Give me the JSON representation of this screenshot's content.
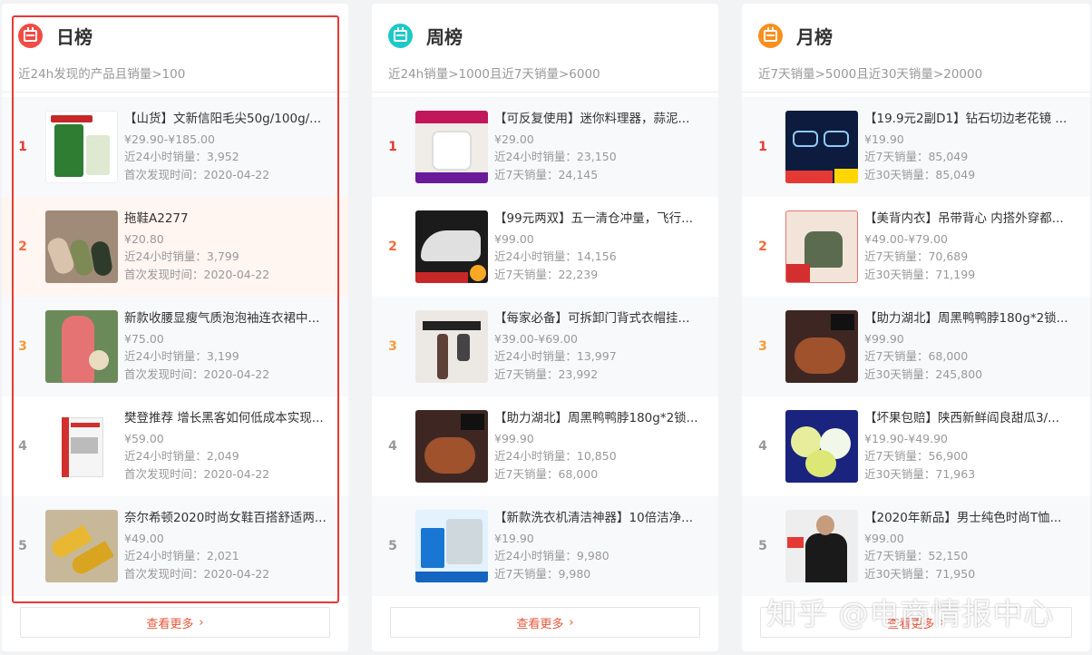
{
  "panels": [
    {
      "title": "日榜",
      "subtitle": "近24h发现的产品且销量>100",
      "icon": "calendar-icon",
      "icon_color": "#f04b45",
      "more_label": "查看更多",
      "items": [
        {
          "rank": "1",
          "name": "【山货】文新信阳毛尖50g/100g/...",
          "price": "¥29.90-¥185.00",
          "line1": "近24小时销量：3,952",
          "line2": "首次发现时间：2020-04-22"
        },
        {
          "rank": "2",
          "name": "拖鞋A2277",
          "price": "¥20.80",
          "line1": "近24小时销量：3,799",
          "line2": "首次发现时间：2020-04-22"
        },
        {
          "rank": "3",
          "name": "新款收腰显瘦气质泡泡袖连衣裙中...",
          "price": "¥75.00",
          "line1": "近24小时销量：3,199",
          "line2": "首次发现时间：2020-04-22"
        },
        {
          "rank": "4",
          "name": "樊登推荐 增长黑客如何低成本实现...",
          "price": "¥59.00",
          "line1": "近24小时销量：2,049",
          "line2": "首次发现时间：2020-04-22"
        },
        {
          "rank": "5",
          "name": "奈尔希顿2020时尚女鞋百搭舒适两...",
          "price": "¥49.00",
          "line1": "近24小时销量：2,021",
          "line2": "首次发现时间：2020-04-22"
        }
      ]
    },
    {
      "title": "周榜",
      "subtitle": "近24h销量>1000且近7天销量>6000",
      "icon": "calendar-icon",
      "icon_color": "#1ec8c8",
      "more_label": "查看更多",
      "items": [
        {
          "rank": "1",
          "name": "【可反复使用】迷你料理器，蒜泥...",
          "price": "¥29.00",
          "line1": "近24小时销量：23,150",
          "line2": "近7天销量：24,145"
        },
        {
          "rank": "2",
          "name": "【99元两双】五一清仓冲量，飞行...",
          "price": "¥99.00",
          "line1": "近24小时销量：14,156",
          "line2": "近7天销量：22,239"
        },
        {
          "rank": "3",
          "name": "【每家必备】可拆卸门背式衣帽挂...",
          "price": "¥39.00-¥69.00",
          "line1": "近24小时销量：13,997",
          "line2": "近7天销量：23,992"
        },
        {
          "rank": "4",
          "name": "【助力湖北】周黑鸭鸭脖180g*2锁...",
          "price": "¥99.90",
          "line1": "近24小时销量：10,850",
          "line2": "近7天销量：68,000"
        },
        {
          "rank": "5",
          "name": "【新款洗衣机清洁神器】10倍洁净...",
          "price": "¥19.90",
          "line1": "近24小时销量：9,980",
          "line2": "近7天销量：9,980"
        }
      ]
    },
    {
      "title": "月榜",
      "subtitle": "近7天销量>5000且近30天销量>20000",
      "icon": "calendar-icon",
      "icon_color": "#f7901e",
      "more_label": "查看更多",
      "items": [
        {
          "rank": "1",
          "name": "【19.9元2副D1】钻石切边老花镜 ...",
          "price": "¥19.90",
          "line1": "近7天销量：85,049",
          "line2": "近30天销量：85,049"
        },
        {
          "rank": "2",
          "name": "【美背内衣】吊带背心 内搭外穿都...",
          "price": "¥49.00-¥79.00",
          "line1": "近7天销量：70,689",
          "line2": "近30天销量：71,199"
        },
        {
          "rank": "3",
          "name": "【助力湖北】周黑鸭鸭脖180g*2锁...",
          "price": "¥99.90",
          "line1": "近7天销量：68,000",
          "line2": "近30天销量：245,800"
        },
        {
          "rank": "4",
          "name": "【坏果包赔】陕西新鲜阎良甜瓜3/...",
          "price": "¥19.90-¥49.90",
          "line1": "近7天销量：56,900",
          "line2": "近30天销量：71,963"
        },
        {
          "rank": "5",
          "name": "【2020年新品】男士纯色时尚T恤...",
          "price": "¥99.00",
          "line1": "近7天销量：52,150",
          "line2": "近30天销量：71,950"
        }
      ]
    }
  ],
  "rank_colors": [
    "#e53935",
    "#ef6c3c",
    "#f39c3a",
    "#999999",
    "#999999"
  ],
  "watermark": "知乎 @电商情报中心"
}
